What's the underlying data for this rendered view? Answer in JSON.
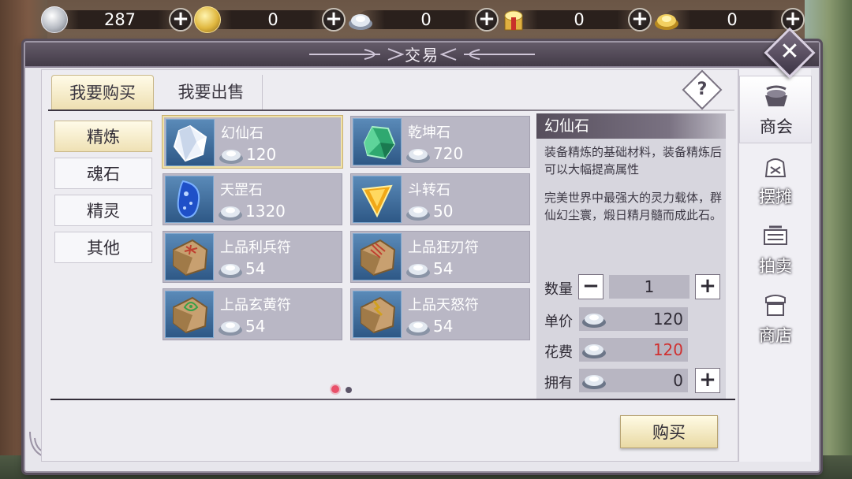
{
  "currency": [
    {
      "icon": "silver-coin-icon",
      "value": "287"
    },
    {
      "icon": "gold-coin-icon",
      "value": "0"
    },
    {
      "icon": "silver-ingot-icon",
      "value": "0"
    },
    {
      "icon": "ingot-box-icon",
      "value": "0"
    },
    {
      "icon": "gold-ingot-icon",
      "value": "0"
    }
  ],
  "window": {
    "title": "交易"
  },
  "tabs": {
    "buy": "我要购买",
    "sell": "我要出售"
  },
  "categories": [
    "精炼",
    "魂石",
    "精灵",
    "其他"
  ],
  "items": [
    {
      "name": "幻仙石",
      "price": "120",
      "icon": "white-crystal-icon",
      "color": "#e8eef8"
    },
    {
      "name": "乾坤石",
      "price": "720",
      "icon": "green-crystal-icon",
      "color": "#3cb87c"
    },
    {
      "name": "天罡石",
      "price": "1320",
      "icon": "blue-crystal-icon",
      "color": "#2a6ad8"
    },
    {
      "name": "斗转石",
      "price": "50",
      "icon": "amber-crystal-icon",
      "color": "#e0a020"
    },
    {
      "name": "上品利兵符",
      "price": "54",
      "icon": "talisman-icon",
      "color": "#c04030"
    },
    {
      "name": "上品狂刃符",
      "price": "54",
      "icon": "talisman-icon",
      "color": "#c04030"
    },
    {
      "name": "上品玄黄符",
      "price": "54",
      "icon": "talisman-icon",
      "color": "#38a048"
    },
    {
      "name": "上品天怒符",
      "price": "54",
      "icon": "talisman-icon",
      "color": "#d0a020"
    }
  ],
  "detail": {
    "title": "幻仙石",
    "desc1": "装备精炼的基础材料，装备精炼后可以大幅提高属性",
    "desc2": "完美世界中最强大的灵力载体，群仙幻尘寰，煅日精月髓而成此石。",
    "quantity_label": "数量",
    "quantity": "1",
    "unit_price_label": "单价",
    "unit_price": "120",
    "cost_label": "花费",
    "cost": "120",
    "cost_color": "#d03030",
    "owned_label": "拥有",
    "owned": "0"
  },
  "buy_button": "购买",
  "side_nav": [
    {
      "label": "商会",
      "icon": "guild-icon"
    },
    {
      "label": "摆摊",
      "icon": "stall-icon"
    },
    {
      "label": "拍卖",
      "icon": "auction-icon"
    },
    {
      "label": "商店",
      "icon": "shop-icon"
    }
  ]
}
